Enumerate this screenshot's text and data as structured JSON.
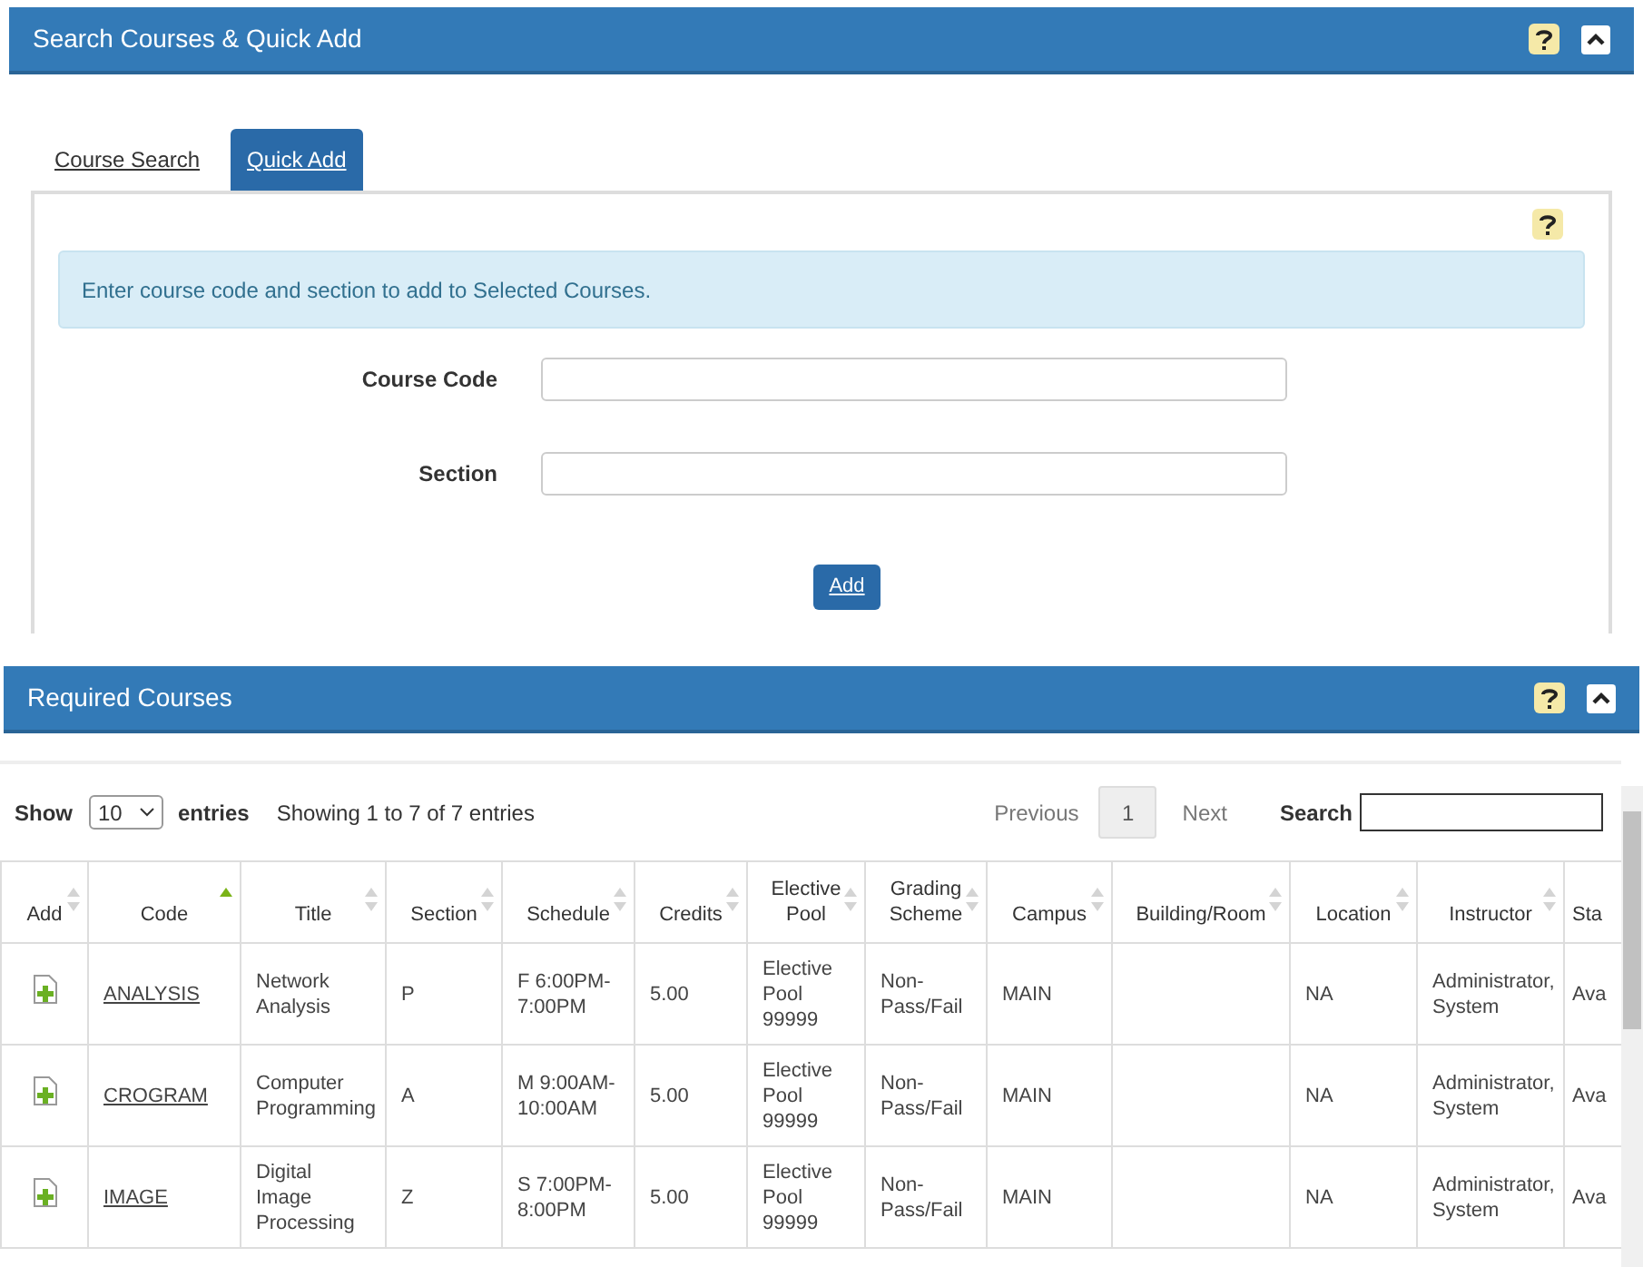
{
  "search_panel": {
    "title": "Search Courses & Quick Add",
    "tabs": [
      {
        "label": "Course Search",
        "selected": false
      },
      {
        "label": "Quick Add",
        "selected": true
      }
    ],
    "info": "Enter course code and section to add to Selected Courses.",
    "fields": [
      {
        "label": "Course Code"
      },
      {
        "label": "Section"
      }
    ],
    "add_button": "Add"
  },
  "required_panel": {
    "title": "Required Courses",
    "show_label": "Show",
    "page_size": "10",
    "entries_label": "entries",
    "showing": "Showing 1 to 7 of 7 entries",
    "previous": "Previous",
    "page": "1",
    "next": "Next",
    "search_label": "Search",
    "columns": [
      {
        "label": "Add",
        "sorted": false
      },
      {
        "label": "Code",
        "sorted": true
      },
      {
        "label": "Title",
        "sorted": false
      },
      {
        "label": "Section",
        "sorted": false
      },
      {
        "label": "Schedule",
        "sorted": false
      },
      {
        "label": "Credits",
        "sorted": false
      },
      {
        "label": "Elective Pool",
        "sorted": false
      },
      {
        "label": "Grading Scheme",
        "sorted": false
      },
      {
        "label": "Campus",
        "sorted": false
      },
      {
        "label": "Building/Room",
        "sorted": false
      },
      {
        "label": "Location",
        "sorted": false
      },
      {
        "label": "Instructor",
        "sorted": false
      },
      {
        "label": "Sta"
      }
    ],
    "rows": [
      {
        "code": "ANALYSIS",
        "title": "Network Analysis",
        "section": "P",
        "schedule": "F 6:00PM-7:00PM",
        "credits": "5.00",
        "pool": "Elective Pool 99999",
        "grading": "Non-Pass/Fail",
        "campus": "MAIN",
        "room": "",
        "location": "NA",
        "instructor": "Administrator, System",
        "status": "Ava"
      },
      {
        "code": "CROGRAM",
        "title": "Computer Programming",
        "section": "A",
        "schedule": "M 9:00AM-10:00AM",
        "credits": "5.00",
        "pool": "Elective Pool 99999",
        "grading": "Non-Pass/Fail",
        "campus": "MAIN",
        "room": "",
        "location": "NA",
        "instructor": "Administrator, System",
        "status": "Ava"
      },
      {
        "code": "IMAGE",
        "title": "Digital Image Processing",
        "section": "Z",
        "schedule": "S 7:00PM-8:00PM",
        "credits": "5.00",
        "pool": "Elective Pool 99999",
        "grading": "Non-Pass/Fail",
        "campus": "MAIN",
        "room": "",
        "location": "NA",
        "instructor": "Administrator, System",
        "status": "Ava"
      }
    ]
  }
}
